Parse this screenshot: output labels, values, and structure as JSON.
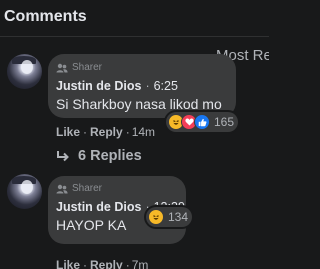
{
  "header": {
    "title": "Comments",
    "sort_label": "Most Re"
  },
  "comments": [
    {
      "badge": "Sharer",
      "author": "Justin de Dios",
      "time": "6:25",
      "text": "Si Sharkboy nasa likod mo",
      "reactions": [
        "haha",
        "love",
        "like"
      ],
      "reaction_count": "165",
      "actions": {
        "like": "Like",
        "reply": "Reply",
        "age": "14m"
      },
      "replies_label": "6 Replies"
    },
    {
      "badge": "Sharer",
      "author": "Justin de Dios",
      "time": "12:39",
      "text": "HAYOP KA",
      "reactions": [
        "haha"
      ],
      "reaction_count": "134",
      "actions": {
        "like": "Like",
        "reply": "Reply",
        "age": "7m"
      }
    }
  ],
  "colors": {
    "background": "#18191a",
    "bubble": "#3a3b3c",
    "text": "#e4e6eb",
    "secondary_text": "#b0b3b8",
    "like_blue": "#1877f2",
    "love_red": "#f33e58",
    "haha_yellow": "#f7b928"
  },
  "icons": {
    "badge": "sharer-people-icon",
    "replies": "reply-arrow-icon",
    "reactions": [
      "haha-reaction-icon",
      "love-reaction-icon",
      "like-reaction-icon"
    ]
  }
}
